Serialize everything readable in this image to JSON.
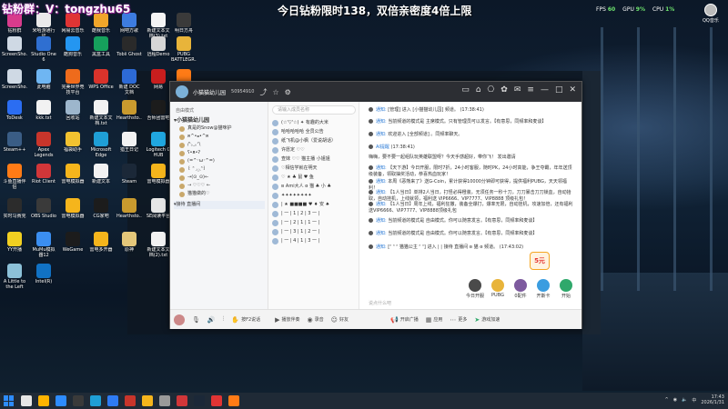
{
  "overlay": {
    "streamer_id": "钻粉群：V：tongzhu65",
    "banner": "今日钻粉限时138，双倍亲密度4倍上限"
  },
  "perf": {
    "fps_label": "FPS",
    "fps_value": "60",
    "gpu_label": "GPU",
    "gpu_value": "9%",
    "cpu_label": "CPU",
    "cpu_value": "1%"
  },
  "qq_corner": {
    "label": "QQ音乐"
  },
  "desktop_icons": [
    {
      "label": "钻粉群",
      "color": "#d83b8c"
    },
    {
      "label": "米哈游通行证",
      "color": "#eaeaea"
    },
    {
      "label": "网易云音乐",
      "color": "#e03434"
    },
    {
      "label": "酷我音乐",
      "color": "#f1a62a"
    },
    {
      "label": "网吧方歌",
      "color": "#3d7ce0"
    },
    {
      "label": "新建文本文档(3).txt",
      "color": "#f4f4f4"
    },
    {
      "label": "明日方舟",
      "color": "#3a3a3a"
    },
    {
      "label": "ScreenSho...",
      "color": "#cfd9e4"
    },
    {
      "label": "Studio One 6",
      "color": "#2f6fd1"
    },
    {
      "label": "酷狗音乐",
      "color": "#2496f1"
    },
    {
      "label": "黑盒工具",
      "color": "#16a05c"
    },
    {
      "label": "Tobii Ghost",
      "color": "#2a2a2a"
    },
    {
      "label": "远程Demo",
      "color": "#d6d6d6"
    },
    {
      "label": "PUBG BATTLEGR...",
      "color": "#e8b43a"
    },
    {
      "label": "ScreenSho...",
      "color": "#cfd9e4"
    },
    {
      "label": "此电脑",
      "color": "#6fb6f2"
    },
    {
      "label": "完美世界竞技平台",
      "color": "#ee6b1c"
    },
    {
      "label": "WPS Office",
      "color": "#d9332b"
    },
    {
      "label": "新建 DOC 文档",
      "color": "#2d6ad6"
    },
    {
      "label": "网易",
      "color": "#c81e1e"
    },
    {
      "label": "斗鱼直播",
      "color": "#ff7b16"
    },
    {
      "label": "ToDesk",
      "color": "#2b6df2"
    },
    {
      "label": "kkk.txt",
      "color": "#f2f2f2"
    },
    {
      "label": "回收站",
      "color": "#9db6cc"
    },
    {
      "label": "新建文本文档.txt",
      "color": "#f2f2f2"
    },
    {
      "label": "Hearthsto...",
      "color": "#c99a2e"
    },
    {
      "label": "吾师团雷吧",
      "color": "#1c1c1c"
    },
    {
      "label": "控制面板",
      "color": "#4d8fd8"
    },
    {
      "label": "Steam++",
      "color": "#3a5d85"
    },
    {
      "label": "Apex Legends",
      "color": "#c8352b"
    },
    {
      "label": "福袋助手",
      "color": "#f2c230"
    },
    {
      "label": "Microsoft Edge",
      "color": "#1f9fd6"
    },
    {
      "label": "猎王日记",
      "color": "#f2f2f2"
    },
    {
      "label": "Logitech G HUB",
      "color": "#20a7e0"
    },
    {
      "label": "小鹿代言成绩",
      "color": "#f2f2f2"
    },
    {
      "label": "斗鱼直播伴侣",
      "color": "#ff7b16"
    },
    {
      "label": "Riot Client",
      "color": "#d13639"
    },
    {
      "label": "雷电模拟器",
      "color": "#f5b51c"
    },
    {
      "label": "新建文本",
      "color": "#f2f2f2"
    },
    {
      "label": "Steam",
      "color": "#1b2838"
    },
    {
      "label": "雷电模拟器",
      "color": "#f5b51c"
    },
    {
      "label": "腾讯会议",
      "color": "#2e7bf3"
    },
    {
      "label": "实时马赛克",
      "color": "#2c2c2c"
    },
    {
      "label": "OBS Studio",
      "color": "#3a3a3a"
    },
    {
      "label": "雷电模拟器",
      "color": "#f5b51c"
    },
    {
      "label": "CG家吧",
      "color": "#1c1c1c"
    },
    {
      "label": "Hearthsto...",
      "color": "#c99a2e"
    },
    {
      "label": "SE阅读平台",
      "color": "#e6e6e6"
    },
    {
      "label": "雷电游戏",
      "color": "#f5b51c"
    },
    {
      "label": "YY开播",
      "color": "#f2d021"
    },
    {
      "label": "MuMu模拟器12",
      "color": "#3b8ef0"
    },
    {
      "label": "WeGame",
      "color": "#1c1c1c"
    },
    {
      "label": "雷电多开器",
      "color": "#f5b51c"
    },
    {
      "label": "原神",
      "color": "#e4c77a"
    },
    {
      "label": "新建文本文档(2).txt",
      "color": "#f2f2f2"
    },
    {
      "label": "LEGO Party!",
      "color": "#e82d2d"
    },
    {
      "label": "A Little to the Left",
      "color": "#8cc1d8"
    },
    {
      "label": "Intel(R)",
      "color": "#1172c4"
    }
  ],
  "app": {
    "name": "小猫猫幼儿园",
    "room_id": "50954910",
    "left": {
      "mode_label": "自由模式",
      "room_name": "小猫猫幼儿园",
      "seats": [
        "真是的Snow@猫咪护",
        "ฅ^•ﻌ•^ฅ",
        "/ᐠ｡ꞈ｡ᐟ\\",
        "ʕ•ᴥ•ʔ",
        "(=^･ω･^=)",
        "꒰ ᐢ ◞‸◟ᐢ꒱",
        "→(⊙_⊙)←",
        "→ ♡♡♡ ←",
        "猫猫做的♡"
      ],
      "bottom_channel": "接待 直播间"
    },
    "user_search_placeholder": "请输入成员名称",
    "users": [
      "(☆'▽'☆)  ✦ 有趣的大米",
      "哈哈哈哈哈 全员公告",
      "纸飞机@小枫（爱说胡话）",
      "许愿定  ♡♡",
      "查妹  ♡♡  猫主播 小姐姐",
      "♡相信学就在明天",
      "♡  ★  ♣  鼠 ♥ 鱼",
      "ʚ Ami大人 ɞ 猫 ♣ 小 ♣",
      "✦✦✦✦✦✦✦✦",
      "| ★ ■■■■ ♥ ♦ 安 ♠",
      "| 一 | 1 | 2 | 3 一 |",
      "| 一 | 2 | 1 | 1 一 |",
      "| 一 | 3 | 1 | 2 一 |",
      "| 一 | 4 | 1 | 3 一 |"
    ],
    "messages": [
      {
        "tag": "通知:",
        "text": "[管理] 进入 [小猫猫幼儿园] 频道。 (17:38:41)"
      },
      {
        "tag": "通知:",
        "text": "当前频道的模式是 主席模式。只有管理员可以发言。【有意思，同频率和麦谈】"
      },
      {
        "tag": "通知:",
        "text": "欢迎进入 [全部频道] 。同频率聊天。"
      },
      {
        "tag": "AI提醒",
        "text": "(17:38:41)"
      },
      {
        "tag": "",
        "text": "嗨嗨，要不要一起组队玩英雄联盟呀？今天手感超好，带你飞！ 发出邀请"
      },
      {
        "tag": "通知:",
        "text": "【天下游】今日开服，限时7折，24小时客服，随时PK，24小时高能，争王夺霸，年年送顶级装备，领取抽奖活动，恭喜热血玩家！"
      },
      {
        "tag": "通知:",
        "text": "本周《恶熊来了》送G-Coin，累计获得10000分钟即可获得，提供福利PUBG，天天领福利！"
      },
      {
        "tag": "通知:",
        "text": "【1人当日】单排2人当日，打怪必得橙装，无须任务一秒十刀，刀刀暴击刀刀锁血，自动拾取，自动挂机，上线就领，福利送 VIP6666、VIP7777、VIP8888 顶级礼包！"
      },
      {
        "tag": "通知:",
        "text": "【1人当日】周年上线，福利狂撒，装备全爆打，爆率无限，自动挂机，攻速加倍，还有福利送VIP6666、VIP7777、VIP8888顶级礼包"
      },
      {
        "tag": "通知:",
        "text": "当前频道的模式是 自由模式。你可以随意发言。【有意思，同频率和麦谈】"
      },
      {
        "tag": "通知:",
        "text": "当前频道的模式是 自由模式。你可以随意发言。【有意思，同频率和麦谈】"
      },
      {
        "tag": "通知:",
        "text": "[ᐢ ᐢ ᐢ 猫猫公主 ᐢ ᐢ] 进入 | | 接待 直播间 ʚ 猫 ɞ 频道。 (17:43:02)"
      }
    ],
    "gifts": [
      {
        "label": "今日开服",
        "color": "#4a4a4a"
      },
      {
        "label": "PUBG",
        "color": "#e8b43a"
      },
      {
        "label": "0配件",
        "color": "#7d5a9e"
      },
      {
        "label": "开斯卡",
        "color": "#3b9de0"
      },
      {
        "label": "开始",
        "color": "#2fa86b"
      }
    ],
    "red_badge": "5元",
    "chat_placeholder": "说点什么吧",
    "bottom": {
      "mic": "按F2说话",
      "share": "播放伴奏",
      "record": "录音",
      "contest": "好友",
      "broadcast": "开启广播",
      "apps": "应用",
      "more": "更多",
      "accelerate": "游戏加速"
    }
  },
  "taskbar": {
    "tray_text": "中",
    "time": "17:43",
    "date": "2026/1/31"
  }
}
